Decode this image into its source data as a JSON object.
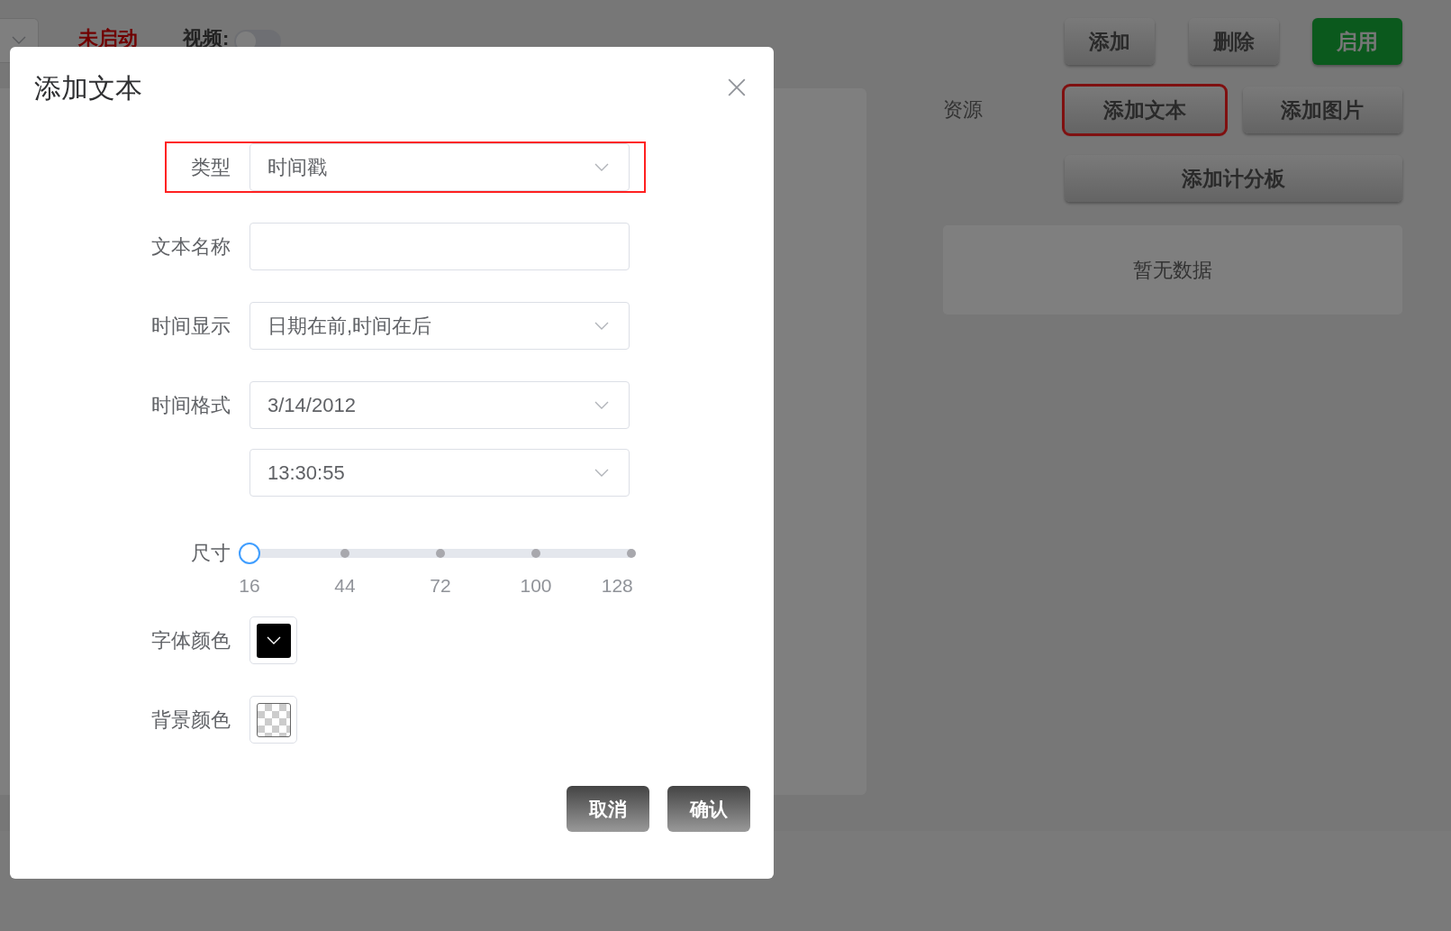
{
  "background": {
    "top_bar": {
      "status": "未启动",
      "video_label": "视频:",
      "video_toggle": {
        "on": false
      }
    },
    "actions": [
      {
        "label": "添加",
        "kind": "plain"
      },
      {
        "label": "删除",
        "kind": "plain"
      },
      {
        "label": "启用",
        "kind": "primary"
      }
    ],
    "resources": {
      "label": "资源",
      "buttons": [
        {
          "label": "添加文本",
          "highlighted": true
        },
        {
          "label": "添加图片",
          "highlighted": false
        },
        {
          "label": "添加计分板",
          "highlighted": false
        }
      ],
      "empty_text": "暂无数据"
    }
  },
  "dialog": {
    "title": "添加文本",
    "rows": [
      {
        "kind": "select",
        "label": "类型",
        "value": "时间戳",
        "highlighted": true
      },
      {
        "kind": "input",
        "label": "文本名称",
        "highlighted": false
      },
      {
        "kind": "select",
        "label": "时间显示",
        "value": "日期在前,时间在后",
        "highlighted": false
      },
      {
        "kind": "select",
        "label": "时间格式",
        "value": "3/14/2012",
        "highlighted": false
      },
      {
        "kind": "select",
        "value": "13:30:55",
        "highlighted": false
      },
      {
        "kind": "slider",
        "label": "尺寸",
        "level": 0,
        "marks": [
          "16",
          "44",
          "72",
          "100",
          "128"
        ],
        "highlighted": false
      },
      {
        "kind": "color",
        "label": "字体颜色",
        "transparent": false,
        "color": "#000000",
        "highlighted": false
      },
      {
        "kind": "color",
        "label": "背景颜色",
        "transparent": true,
        "highlighted": false
      }
    ],
    "buttons": [
      "取消",
      "确认"
    ]
  }
}
